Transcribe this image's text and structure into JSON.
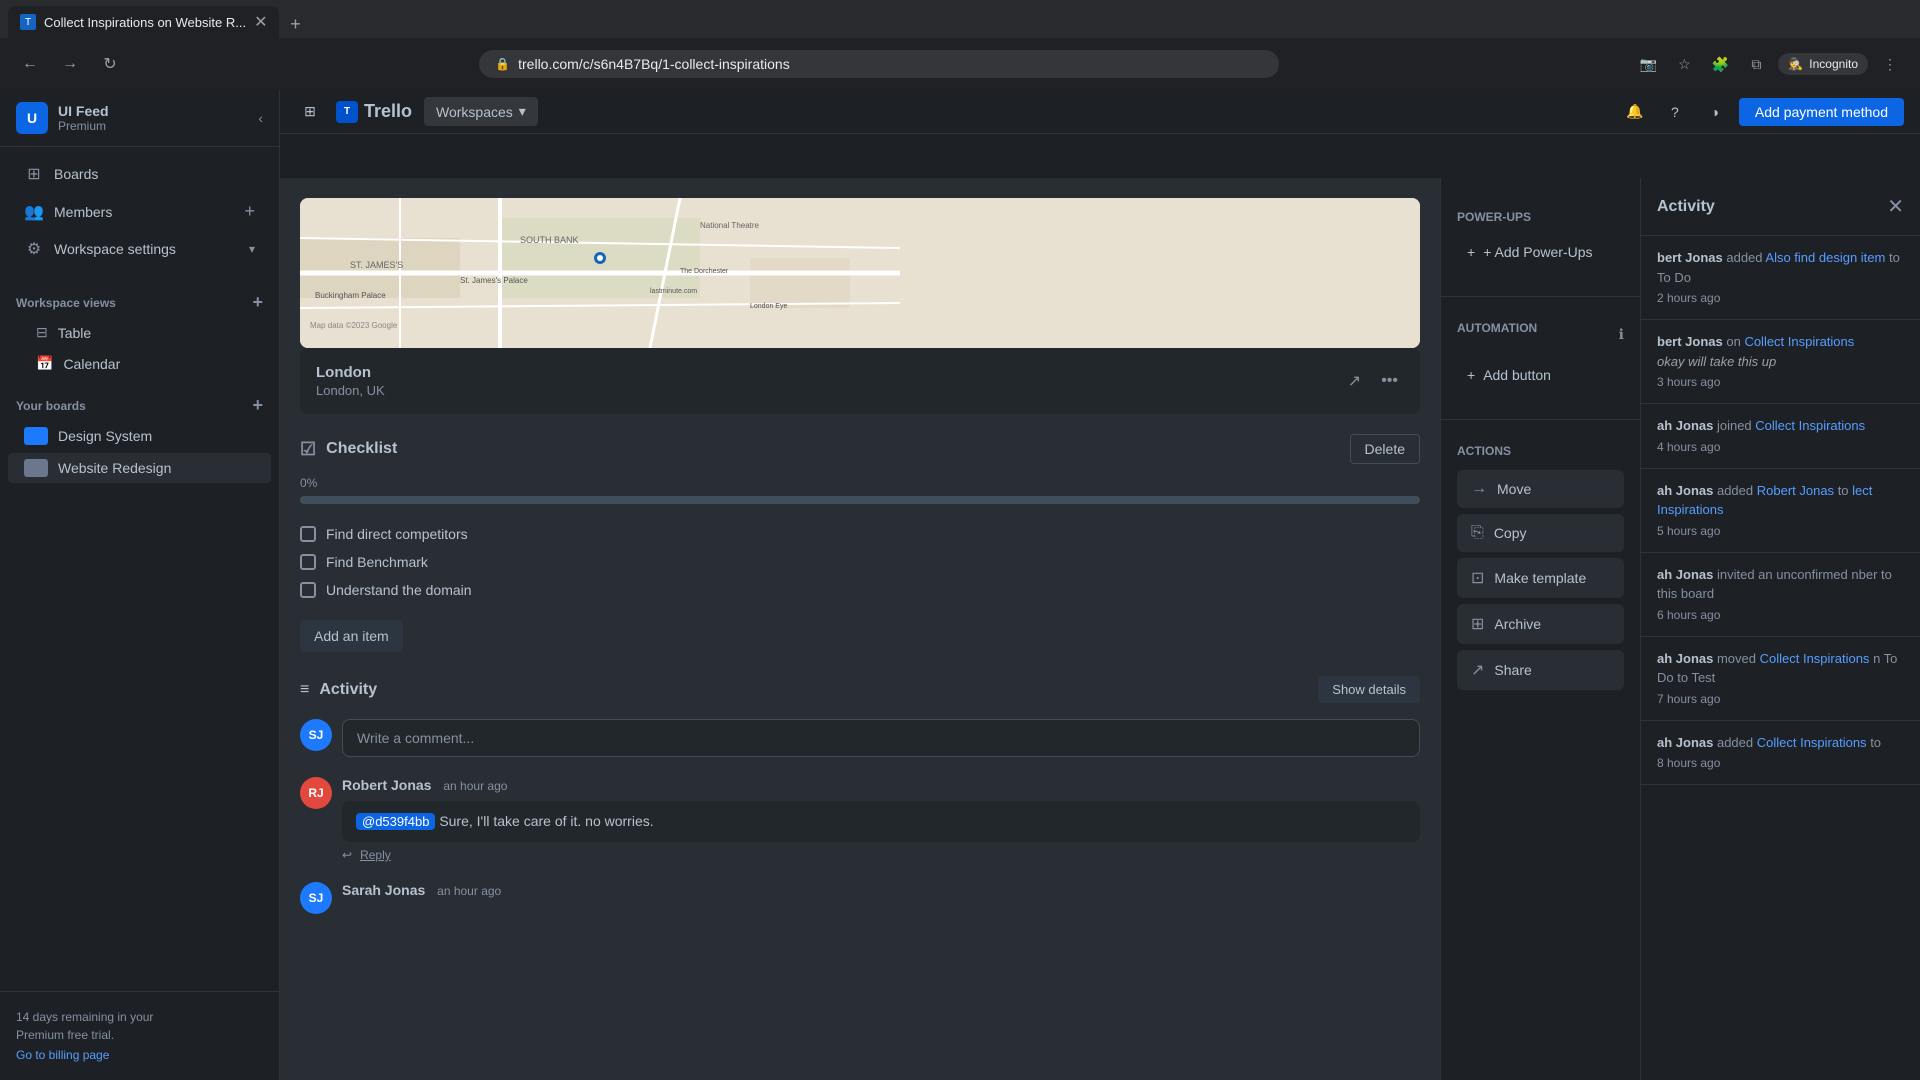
{
  "browser": {
    "tab_title": "Collect Inspirations on Website R...",
    "url": "trello.com/c/s6n4B7Bq/1-collect-inspirations",
    "tab_new": "+",
    "incognito_label": "Incognito"
  },
  "topbar": {
    "logo": "Trello",
    "workspaces_btn": "Workspaces",
    "payment_btn": "Add payment method"
  },
  "sidebar": {
    "workspace_name": "UI Feed",
    "workspace_plan": "Premium",
    "workspace_initial": "U",
    "nav_items": [
      {
        "label": "Boards",
        "icon": "⊞"
      },
      {
        "label": "Members",
        "icon": "👥"
      },
      {
        "label": "Workspace settings",
        "icon": "⚙"
      }
    ],
    "workspace_views_title": "Workspace views",
    "workspace_views": [
      {
        "label": "Table",
        "icon": "⊟"
      },
      {
        "label": "Calendar",
        "icon": "📅"
      }
    ],
    "your_boards_title": "Your boards",
    "boards": [
      {
        "label": "Design System",
        "color": "#1d7afc"
      },
      {
        "label": "Website Redesign",
        "color": "#6b778c"
      }
    ],
    "trial_text": "14 days remaining in your\nPremium free trial.",
    "billing_link": "Go to billing page"
  },
  "card": {
    "location_name": "London",
    "location_sub": "London, UK",
    "checklist_title": "Checklist",
    "delete_btn": "Delete",
    "progress_label": "0%",
    "items": [
      {
        "text": "Find direct competitors",
        "checked": false
      },
      {
        "text": "Find Benchmark",
        "checked": false
      },
      {
        "text": "Understand the domain",
        "checked": false
      }
    ],
    "add_item_btn": "Add an item",
    "activity_title": "Activity",
    "show_details_btn": "Show details",
    "comment_placeholder": "Write a comment...",
    "comments": [
      {
        "author": "Robert Jonas",
        "time": "an hour ago",
        "avatar_initials": "RJ",
        "avatar_color": "#e2483d",
        "mention": "@d539f4bb",
        "text": "Sure, I'll take care of it. no worries.",
        "reply_icon": "↩",
        "reply_label": "Reply"
      },
      {
        "author": "Sarah Jonas",
        "time": "an hour ago",
        "avatar_initials": "SJ",
        "avatar_color": "#1d7afc"
      }
    ]
  },
  "right_panel": {
    "powerups_title": "Power-Ups",
    "add_powerups_btn": "+ Add Power-Ups",
    "automation_title": "Automation",
    "add_button_btn": "Add button",
    "actions_title": "Actions",
    "actions": [
      {
        "label": "Move",
        "icon": "→"
      },
      {
        "label": "Copy",
        "icon": "⎘"
      },
      {
        "label": "Make template",
        "icon": "⊡"
      },
      {
        "label": "Archive",
        "icon": "⊞"
      },
      {
        "label": "Share",
        "icon": "↗"
      }
    ]
  },
  "activity_panel": {
    "title": "Activity",
    "entries": [
      {
        "author": "bert Jonas",
        "verb": "added",
        "link_text": "Also find design item",
        "suffix": "to To Do",
        "time": "2 hours ago"
      },
      {
        "author": "bert Jonas",
        "verb": "on",
        "link_text": "Collect Inspirations",
        "suffix": "",
        "note": "okay will take this up",
        "time": "3 hours ago"
      },
      {
        "author": "ah Jonas",
        "verb": "joined",
        "link_text": "Collect Inspirations",
        "suffix": "",
        "time": "4 hours ago"
      },
      {
        "author": "ah Jonas",
        "verb": "added",
        "link2": "Robert Jonas",
        "suffix": "to",
        "link_text": "lect Inspirations",
        "time": "5 hours ago"
      },
      {
        "author": "ah Jonas",
        "verb": "invited an unconfirmed",
        "suffix": "nber to this board",
        "time": "6 hours ago"
      },
      {
        "author": "ah Jonas",
        "verb": "moved",
        "link_text": "Collect Inspirations",
        "suffix": "n To Do to Test",
        "time": "7 hours ago"
      },
      {
        "author": "ah Jonas",
        "verb": "added",
        "link_text": "Collect Inspirations",
        "suffix": "to",
        "time": "8 hours ago"
      }
    ]
  }
}
